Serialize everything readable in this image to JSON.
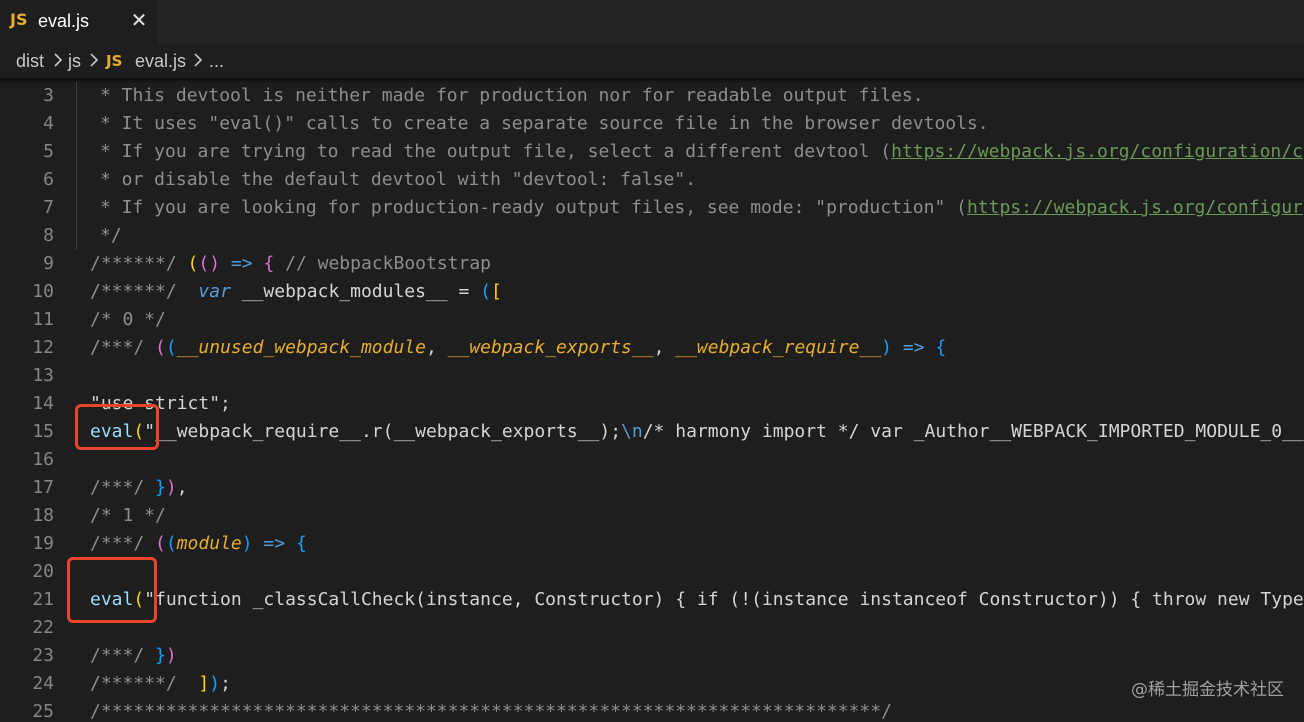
{
  "tab": {
    "icon": "JS",
    "label": "eval.js",
    "close": "✕"
  },
  "breadcrumb": {
    "items": [
      "dist",
      "js",
      "eval.js",
      "..."
    ],
    "file_icon": "JS"
  },
  "gutter": {
    "numbers": [
      "3",
      "4",
      "5",
      "6",
      "7",
      "8",
      "9",
      "10",
      "11",
      "12",
      "13",
      "14",
      "15",
      "16",
      "17",
      "18",
      "19",
      "20",
      "21",
      "22",
      "23",
      "24",
      "25"
    ]
  },
  "code": {
    "l3": "* This devtool is neither made for production nor for readable output files.",
    "l4": "* It uses \"eval()\" calls to create a separate source file in the browser devtools.",
    "l5a": "* If you are trying to read the output file, select a different devtool (",
    "l5b": "https://webpack.js.org/configuration/c",
    "l6": "* or disable the default devtool with \"devtool: false\".",
    "l7a": "* If you are looking for production-ready output files, see mode: \"production\" (",
    "l7b": "https://webpack.js.org/configur",
    "l8": "*/",
    "l9_com": "/******/ ",
    "l9_tail": " // webpackBootstrap",
    "l10_com": "/******/ ",
    "l10_kw": "var",
    "l10_name": " __webpack_modules__ ",
    "l11": "/* 0 */",
    "l12_com": "/***/ ",
    "l12_p1": "__unused_webpack_module",
    "l12_p2": "__webpack_exports__",
    "l12_p3": "__webpack_require__",
    "l14": "\"use strict\";",
    "l15_fn": "eval",
    "l15_a": "\"__webpack_require__.r(__webpack_exports__);",
    "l15_esc": "\\n",
    "l15_b": "/* harmony import */ var _Author__WEBPACK_IMPORTED_MODULE_0__",
    "l17_com": "/***/ ",
    "l18": "/* 1 */",
    "l19_com": "/***/ ",
    "l19_p": "module",
    "l21_fn": "eval",
    "l21_a": "\"function _classCallCheck(instance, Constructor) { if (!(instance instanceof Constructor)) { throw new Type",
    "l23_com": "/***/ ",
    "l24_com": "/******/ ",
    "l25": "/************************************************************************/"
  },
  "watermark": "@稀土掘金技术社区",
  "colors": {
    "annotation": "#e8452c",
    "js_badge": "#e6ad30",
    "comment": "#6a9955"
  }
}
